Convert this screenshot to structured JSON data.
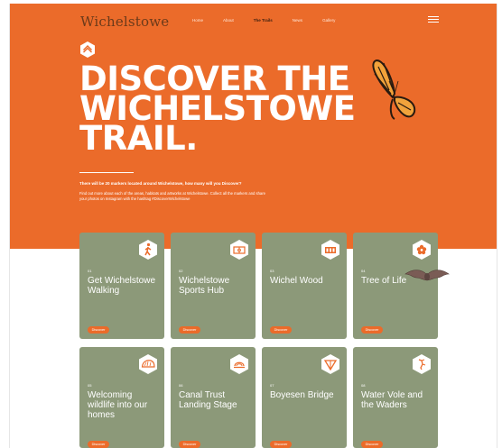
{
  "site": {
    "logo": "Wichelstowe",
    "nav": [
      "Home",
      "About",
      "The Trails",
      "News",
      "Gallery"
    ],
    "active_nav": "The Trails"
  },
  "hero": {
    "title_lines": [
      "DISCOVER THE",
      "WICHELSTOWE",
      "TRAIL."
    ],
    "intro_bold": "There will be 20 markers located around Wichelstowe, how many will you Discover?",
    "intro": "Find out more about each of the areas, habitats and artworks at Wichelstowe. Collect all the markers and share your photos on Instagram with the hashtag #DiscoverWichelstowe",
    "accent_color": "#eb6b2a"
  },
  "cards": [
    {
      "num": "01",
      "name": "Get Wichelstowe Walking",
      "button": "Discover",
      "icon": "walking-person-icon"
    },
    {
      "num": "02",
      "name": "Wichelstowe Sports Hub",
      "button": "Discover",
      "icon": "sports-hub-icon"
    },
    {
      "num": "03",
      "name": "Wichel Wood",
      "button": "Discover",
      "icon": "wood-icon"
    },
    {
      "num": "04",
      "name": "Tree of Life",
      "button": "Discover",
      "icon": "flower-icon"
    },
    {
      "num": "05",
      "name": "Welcoming wildlife into our homes",
      "button": "Discover",
      "icon": "hedgehog-icon"
    },
    {
      "num": "06",
      "name": "Canal Trust Landing Stage",
      "button": "Discover",
      "icon": "landing-stage-icon"
    },
    {
      "num": "07",
      "name": "Boyesen Bridge",
      "button": "Discover",
      "icon": "bridge-icon"
    },
    {
      "num": "08",
      "name": "Water Vole and the Waders",
      "button": "Discover",
      "icon": "heron-icon"
    }
  ],
  "card_color": "#8c9979"
}
